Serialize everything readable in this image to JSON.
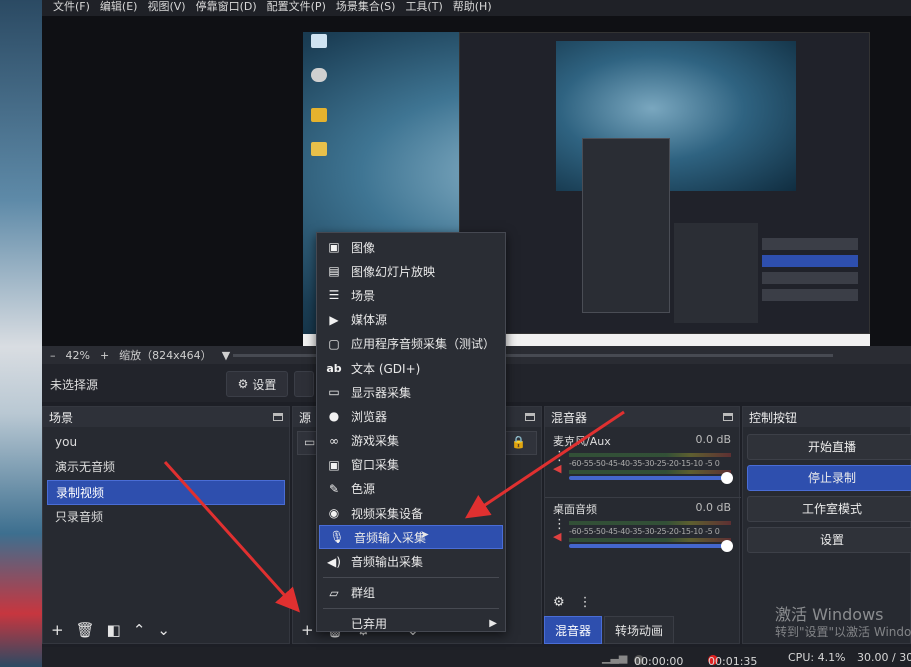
{
  "menu": [
    "文件(F)",
    "编辑(E)",
    "视图(V)",
    "停靠窗口(D)",
    "配置文件(P)",
    "场景集合(S)",
    "工具(T)",
    "帮助(H)"
  ],
  "zoom": {
    "minus": "–",
    "value": "42%",
    "plus": "+",
    "scale_label": "缩放（824x464）"
  },
  "source_toolbar": {
    "no_source": "未选择源",
    "settings_label": "设置"
  },
  "scenes": {
    "title": "场景",
    "items": [
      "you",
      "演示无音频",
      "录制视频",
      "只录音频"
    ],
    "active_index": 2
  },
  "sources": {
    "title": "源"
  },
  "mixer": {
    "title": "混音器",
    "channels": [
      {
        "name": "麦克风/Aux",
        "db": "0.0 dB",
        "ticks": "-60-55-50-45-40-35-30-25-20-15-10 -5 0"
      },
      {
        "name": "桌面音频",
        "db": "0.0 dB",
        "ticks": "-60-55-50-45-40-35-30-25-20-15-10 -5 0"
      }
    ],
    "tabs": [
      "混音器",
      "转场动画"
    ]
  },
  "controls": {
    "title": "控制按钮",
    "buttons": [
      "开始直播",
      "停止录制",
      "工作室模式",
      "设置"
    ],
    "active_index": 1
  },
  "context_menu": {
    "items": [
      {
        "label": "图像",
        "icon": "image-icon"
      },
      {
        "label": "图像幻灯片放映",
        "icon": "slideshow-icon"
      },
      {
        "label": "场景",
        "icon": "list-icon"
      },
      {
        "label": "媒体源",
        "icon": "play-icon"
      },
      {
        "label": "应用程序音频采集（测试）",
        "icon": "app-audio-icon"
      },
      {
        "label": "文本 (GDI+)",
        "icon": "text-icon"
      },
      {
        "label": "显示器采集",
        "icon": "monitor-icon"
      },
      {
        "label": "浏览器",
        "icon": "globe-icon"
      },
      {
        "label": "游戏采集",
        "icon": "gamepad-icon"
      },
      {
        "label": "窗口采集",
        "icon": "window-icon"
      },
      {
        "label": "色源",
        "icon": "brush-icon"
      },
      {
        "label": "视频采集设备",
        "icon": "camera-icon"
      },
      {
        "label": "音频输入采集",
        "icon": "microphone-icon"
      },
      {
        "label": "音频输出采集",
        "icon": "speaker-icon"
      },
      {
        "label": "群组",
        "icon": "folder-icon"
      },
      {
        "label": "已弃用",
        "icon": ""
      }
    ],
    "highlighted_index": 12
  },
  "status": {
    "stream_time": "00:00:00",
    "record_time": "00:01:35",
    "cpu": "CPU: 4.1%",
    "fps": "30.00 / 30."
  },
  "watermark": {
    "line1": "激活 Windows",
    "line2": "转到\"设置\"以激活 Windo"
  },
  "colors": {
    "accent": "#2e4fae",
    "annotation_arrow": "#e03030",
    "record_dot": "#e02020"
  }
}
